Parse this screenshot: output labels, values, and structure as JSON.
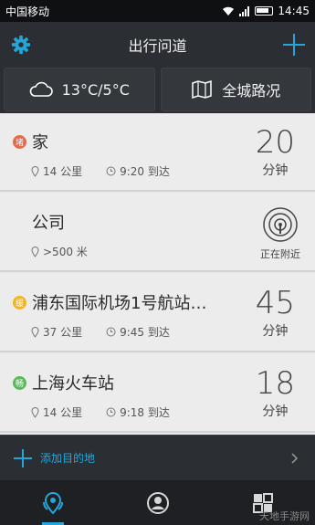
{
  "status": {
    "carrier": "中国移动",
    "time": "14:45"
  },
  "header": {
    "title": "出行问道"
  },
  "quick": {
    "weather": "13°C/5°C",
    "traffic": "全城路况"
  },
  "destinations": [
    {
      "name": "家",
      "badge": "堵",
      "badge_color": "#e06b4f",
      "distance": "14 公里",
      "arrival": "9:20 到达",
      "minutes": "20",
      "unit": "分钟"
    },
    {
      "name": "公司",
      "distance": ">500 米",
      "nearby": "正在附近"
    },
    {
      "name": "浦东国际机场1号航站…",
      "badge": "缓",
      "badge_color": "#f0b429",
      "distance": "37 公里",
      "arrival": "9:45 到达",
      "minutes": "45",
      "unit": "分钟"
    },
    {
      "name": "上海火车站",
      "badge": "畅",
      "badge_color": "#5bb85c",
      "distance": "14 公里",
      "arrival": "9:18 到达",
      "minutes": "18",
      "unit": "分钟"
    }
  ],
  "add": {
    "label": "添加目的地"
  },
  "colors": {
    "accent": "#25a6d9",
    "bg": "#2b2e33"
  },
  "watermark": "天地手游网"
}
